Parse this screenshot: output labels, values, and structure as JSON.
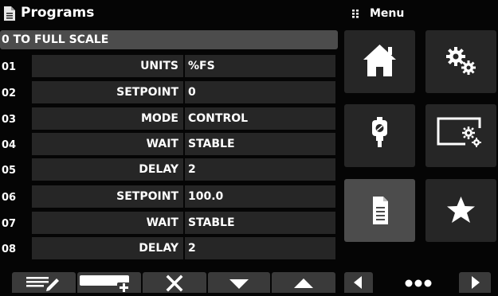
{
  "header": {
    "title": "Programs",
    "icon": "document-icon"
  },
  "menu": {
    "title": "Menu",
    "icon": "grid-icon"
  },
  "program": {
    "title": "0 TO FULL SCALE",
    "rows": [
      {
        "num": "01",
        "param": "UNITS",
        "value": "%FS"
      },
      {
        "num": "02",
        "param": "SETPOINT",
        "value": "0"
      },
      {
        "num": "03",
        "param": "MODE",
        "value": "CONTROL"
      },
      {
        "num": "04",
        "param": "WAIT",
        "value": "STABLE"
      },
      {
        "num": "05",
        "param": "DELAY",
        "value": "2"
      },
      {
        "num": "06",
        "param": "SETPOINT",
        "value": "100.0"
      },
      {
        "num": "07",
        "param": "WAIT",
        "value": "STABLE"
      },
      {
        "num": "08",
        "param": "DELAY",
        "value": "2"
      }
    ]
  },
  "toolbar": {
    "buttons": [
      "edit-icon",
      "insert-step-icon",
      "delete-icon",
      "move-down-icon",
      "move-up-icon"
    ]
  },
  "tiles": [
    "home-icon",
    "settings-icon",
    "sensor-icon",
    "display-settings-icon",
    "programs-icon",
    "favorites-icon"
  ],
  "pager": {
    "prev": "prev-page-icon",
    "dots": "page-dots-icon",
    "next": "next-page-icon"
  },
  "colors": {
    "background": "#050505",
    "cell": "#262626",
    "active_tile": "#4c4c4c",
    "accent": "#1a73c8"
  }
}
